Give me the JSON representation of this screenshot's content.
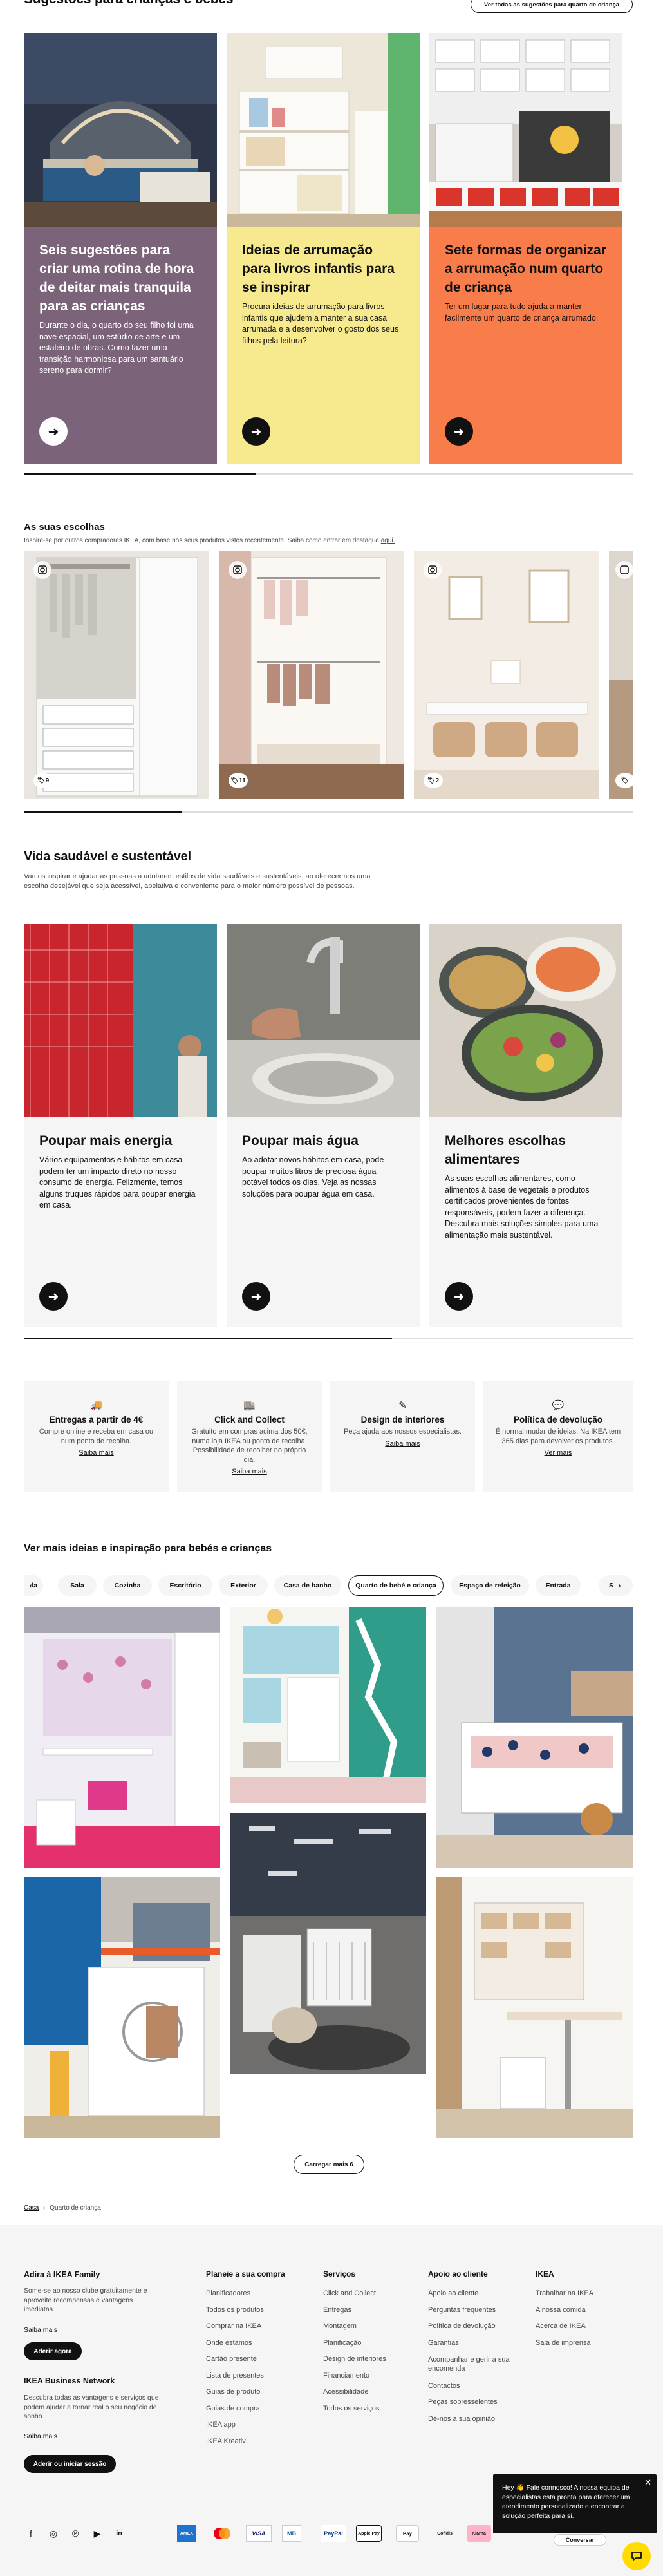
{
  "section1": {
    "title": "Sugestões para crianças e bebés",
    "all_button": "Ver todas as sugestões para quarto de criança",
    "cards": [
      {
        "title": "Seis sugestões para criar uma rotina de hora de deitar mais tranquila para as crianças",
        "text": "Durante o dia, o quarto do seu filho foi uma nave espacial, um estúdio de arte e um estaleiro de obras. Como fazer uma transição harmoniosa para um santuário sereno para dormir?",
        "color": "#7b6479"
      },
      {
        "title": "Ideias de arrumação para livros infantis para se inspirar",
        "text": "Procura ideias de arrumação para livros infantis que ajudem a manter a sua casa arrumada e a desenvolver o gosto dos seus filhos pela leitura?",
        "color": "#f7e98e"
      },
      {
        "title": "Sete formas de organizar a arrumação num quarto de criança",
        "text": "Ter um lugar para tudo ajuda a manter facilmente um quarto de criança arrumado.",
        "color": "#f97d4b"
      }
    ]
  },
  "section2": {
    "title": "As suas escolhas",
    "subtitle": "Inspire-se por outros compradores IKEA, com base nos seus produtos vistos recentemente! Saiba como entrar em destaque",
    "subtitle_link": "aqui.",
    "photos": [
      {
        "tag_count": "9"
      },
      {
        "tag_count": "11"
      },
      {
        "tag_count": "2"
      },
      {
        "tag_count": ""
      }
    ]
  },
  "section3": {
    "title": "Vida saudável e sustentável",
    "subtitle": "Vamos inspirar e ajudar as pessoas a adotarem estilos de vida saudáveis e sustentáveis, ao oferecermos uma escolha desejável que seja acessível, apelativa e conveniente para o maior número possível de pessoas.",
    "cards": [
      {
        "title": "Poupar mais energia",
        "text": "Vários equipamentos e hábitos em casa podem ter um impacto direto no nosso consumo de energia. Felizmente, temos alguns truques rápidos para poupar energia em casa."
      },
      {
        "title": "Poupar mais água",
        "text": "Ao adotar novos hábitos em casa, pode poupar muitos litros de preciosa água potável todos os dias. Veja as nossas soluções para poupar água em casa."
      },
      {
        "title": "Melhores escolhas alimentares",
        "text": "As suas escolhas alimentares, como alimentos à base de vegetais e produtos certificados provenientes de fontes responsáveis, podem fazer a diferença. Descubra mais soluções simples para uma alimentação mais sustentável."
      }
    ]
  },
  "services": [
    {
      "icon": "truck-icon",
      "title": "Entregas a partir de 4€",
      "text": "Compre online e receba em casa ou num ponto de recolha.",
      "link": "Saiba mais"
    },
    {
      "icon": "shop-icon",
      "title": "Click and Collect",
      "text": "Gratuito em compras acima dos 50€, numa loja IKEA ou ponto de recolha. Possibilidade de recolher no próprio dia.",
      "link": "Saiba mais"
    },
    {
      "icon": "pencil-icon",
      "title": "Design de interiores",
      "text": "Peça ajuda aos nossos especialistas.",
      "link": "Saiba mais"
    },
    {
      "icon": "chat-icon",
      "title": "Política de devolução",
      "text": "É normal mudar de ideias. Na IKEA tem 365 dias para devolver os produtos.",
      "link": "Ver mais"
    }
  ],
  "section4": {
    "title": "Ver mais ideias e inspiração para bebés e crianças",
    "chips": [
      "Sala",
      "Cozinha",
      "Escritório",
      "Exterior",
      "Casa de banho",
      "Quarto de bebé e criança",
      "Espaço de refeição",
      "Entrada"
    ],
    "chip_prev_partial": "la",
    "chip_next_partial": "S",
    "selected_chip": "Quarto de bebé e criança",
    "load_more": "Carregar mais 6"
  },
  "breadcrumb": {
    "home": "Casa",
    "current": "Quarto de criança"
  },
  "footer": {
    "family_title": "Adira à IKEA Family",
    "family_text": "Some-se ao nosso clube gratuitamente e aproveite recompensas e vantagens imediatas.",
    "family_link": "Saiba mais",
    "family_button": "Aderir agora",
    "business_title": "IKEA Business Network",
    "business_text": "Descubra todas as vantagens e serviços que podem ajudar a tornar real o seu negócio de sonho.",
    "business_link": "Saiba mais",
    "business_button": "Aderir ou iniciar sessão",
    "columns": [
      {
        "title": "Planeie a sua compra",
        "links": [
          "Planificadores",
          "Todos os produtos",
          "Comprar na IKEA",
          "Onde estamos",
          "Cartão presente",
          "Lista de presentes",
          "Guias de produto",
          "Guias de compra",
          "IKEA app",
          "IKEA Kreativ"
        ]
      },
      {
        "title": "Serviços",
        "links": [
          "Click and Collect",
          "Entregas",
          "Montagem",
          "Planificação",
          "Design de interiores",
          "Financiamento",
          "Acessibilidade",
          "Todos os serviços"
        ]
      },
      {
        "title": "Apoio ao cliente",
        "links": [
          "Apoio ao cliente",
          "Perguntas frequentes",
          "Política de devolução",
          "Garantias",
          "Acompanhar e gerir a sua encomenda",
          "Contactos",
          "Peças sobresselentes",
          "Dê-nos a sua opinião"
        ]
      },
      {
        "title": "IKEA",
        "links": [
          "Trabalhar na IKEA",
          "A nossa cómida",
          "Acerca de IKEA",
          "Sala de imprensa"
        ]
      }
    ],
    "payments": [
      "AMEX",
      "MC",
      "VISA",
      "MB",
      "PayPal",
      "Apple Pay",
      "Pay",
      "Cofidis",
      "Klarna"
    ]
  },
  "chat": {
    "message": "Hey 👋 Fale connosco! A nossa equipa de especialistas está pronta para oferecer um atendimento personalizado e encontrar a solução perfeita para si.",
    "partial_button": "Conversar"
  },
  "colors": {
    "accent": "#0058a3",
    "chat_yellow": "#ffdb00",
    "dark": "#111111"
  }
}
